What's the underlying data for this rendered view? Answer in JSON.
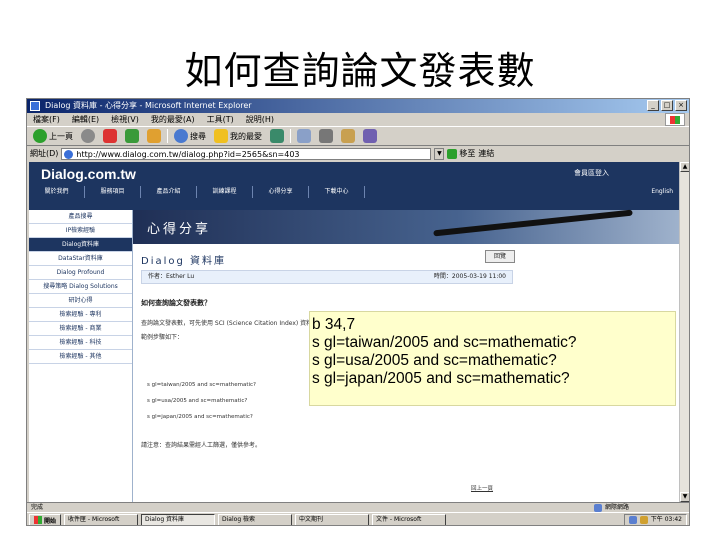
{
  "slide_title": "如何查詢論文發表數",
  "browser": {
    "window_title": "Dialog 資料庫 - 心得分享 - Microsoft Internet Explorer",
    "menu": [
      "檔案(F)",
      "編輯(E)",
      "檢視(V)",
      "我的最愛(A)",
      "工具(T)",
      "說明(H)"
    ],
    "toolbar": {
      "back": "上一頁",
      "search": "搜尋",
      "favorites": "我的最愛"
    },
    "address_label": "網址(D)",
    "url": "http://www.dialog.com.tw/dialog.php?id=2565&sn=403",
    "go_label": "移至",
    "links_label": "連結",
    "status_text": "完成",
    "status_zone": "網際網路"
  },
  "site": {
    "logo": "Dialog.com.tw",
    "top_link": "會員區登入",
    "nav": [
      "關於我們",
      "服務項目",
      "產品介紹",
      "訓練課程",
      "心得分享",
      "下載中心"
    ],
    "nav_right": "English",
    "banner_title": "心得分享",
    "sidebar": [
      "產品搜尋",
      "IP檢索經驗",
      "Dialog資料庫",
      "DataStar資料庫",
      "Dialog Profound",
      "搜尋策略 Dialog Solutions",
      "研討心得",
      "檢索經驗 - 專利",
      "檢索經驗 - 商業",
      "檢索經驗 - 科技",
      "檢索經驗 - 其他"
    ],
    "content_title": "Dialog 資料庫",
    "back_button": "回覽",
    "author": "作者：Esther Lu",
    "date": "時間：2005-03-19 11:00",
    "question": "如何查詢論文發表數？",
    "para1": "查詢論文發表數，可先使用 SCI (Science Citation Index) 資料庫",
    "para2": "範例步驟如下：",
    "s1": "s gl=taiwan/2005 and sc=mathematic?",
    "s2": "s gl=usa/2005 and sc=mathematic?",
    "s3": "s gl=japan/2005 and sc=mathematic?",
    "footer_note": "請注意：查詢結果需經人工篩選，僅供參考。",
    "bottom_link": "回上一頁"
  },
  "taskbar": {
    "start": "開始",
    "tasks": [
      "收件匣 - Microsoft",
      "Dialog 資料庫",
      "Dialog 檢索",
      "中文期刊",
      "文件 - Microsoft"
    ],
    "clock": "下午 03:42"
  },
  "callout": {
    "line1": "b 34,7",
    "line2": "s gl=taiwan/2005 and sc=mathematic?",
    "line3": "s gl=usa/2005 and sc=mathematic?",
    "line4": "s gl=japan/2005 and sc=mathematic?"
  }
}
